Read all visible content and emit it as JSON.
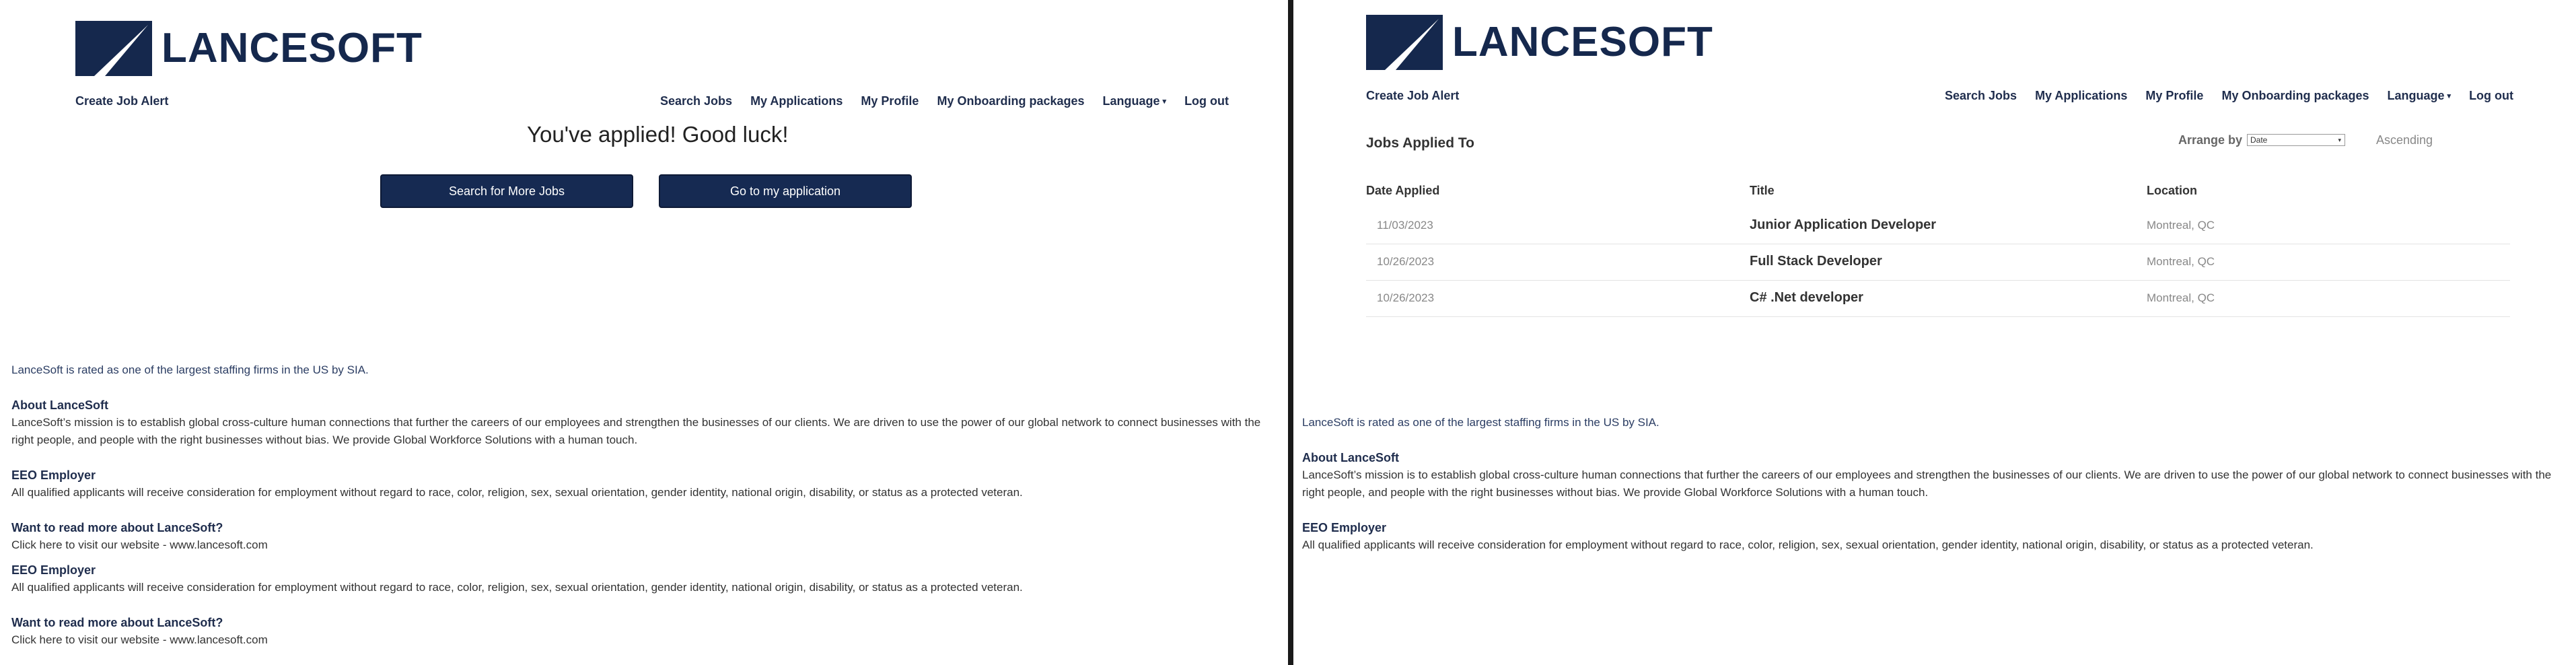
{
  "brand": {
    "name": "LANCESOFT",
    "navy": "#15284d",
    "button_bg": "#162a52"
  },
  "nav": {
    "create_alert": "Create Job Alert",
    "items": [
      "Search Jobs",
      "My Applications",
      "My Profile",
      "My Onboarding packages",
      "Language",
      "Log out"
    ],
    "language_caret": "▾"
  },
  "left": {
    "message": "You've applied! Good luck!",
    "search_more_button": "Search for More Jobs",
    "go_to_application_button": "Go to my application"
  },
  "footer": {
    "intro": "LanceSoft is rated as one of the largest staffing firms in the US by SIA.",
    "about_heading": "About LanceSoft",
    "about_text": "LanceSoft’s mission is to establish global cross-culture human connections that further the careers of our employees and strengthen the businesses of our clients. We are driven to use the power of our global network to connect businesses with the right people, and people with the right businesses without bias. We provide Global Workforce Solutions with a human touch.",
    "eeo_heading": "EEO Employer",
    "eeo_text": "All qualified applicants will receive consideration for employment without regard to race, color, religion, sex, sexual orientation, gender identity, national origin, disability, or status as a protected veteran.",
    "read_more_heading": "Want to read more about LanceSoft?",
    "read_more_text": "Click here to visit our website - www.lancesoft.com"
  },
  "right": {
    "jobs_title": "Jobs Applied To",
    "arrange_label": "Arrange by",
    "arrange_value": "Date",
    "order_label": "Ascending",
    "columns": [
      "Date Applied",
      "Title",
      "Location"
    ],
    "rows": [
      {
        "date": "11/03/2023",
        "title": "Junior Application Developer",
        "location": "Montreal, QC"
      },
      {
        "date": "10/26/2023",
        "title": "Full Stack Developer",
        "location": "Montreal, QC"
      },
      {
        "date": "10/26/2023",
        "title": "C# .Net developer",
        "location": "Montreal, QC"
      }
    ]
  }
}
